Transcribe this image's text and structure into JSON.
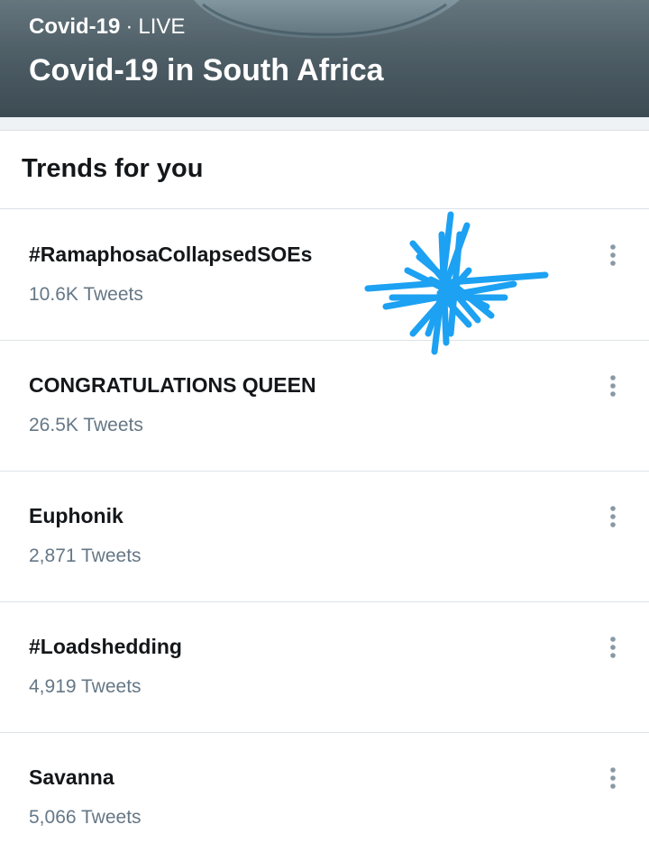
{
  "banner": {
    "category": "Covid-19",
    "separator": "·",
    "status": "LIVE",
    "title": "Covid-19 in South Africa"
  },
  "trends": {
    "heading": "Trends for you",
    "items": [
      {
        "name": "#RamaphosaCollapsedSOEs",
        "count": "10.6K Tweets"
      },
      {
        "name": "CONGRATULATIONS QUEEN",
        "count": "26.5K Tweets"
      },
      {
        "name": "Euphonik",
        "count": "2,871 Tweets"
      },
      {
        "name": "#Loadshedding",
        "count": "4,919 Tweets"
      },
      {
        "name": "Savanna",
        "count": "5,066 Tweets"
      }
    ]
  },
  "icons": {
    "more": "more-vertical-icon"
  },
  "colors": {
    "text_primary": "#14171a",
    "text_secondary": "#657786",
    "divider": "#dde3e7",
    "scribble": "#1da1f2"
  }
}
